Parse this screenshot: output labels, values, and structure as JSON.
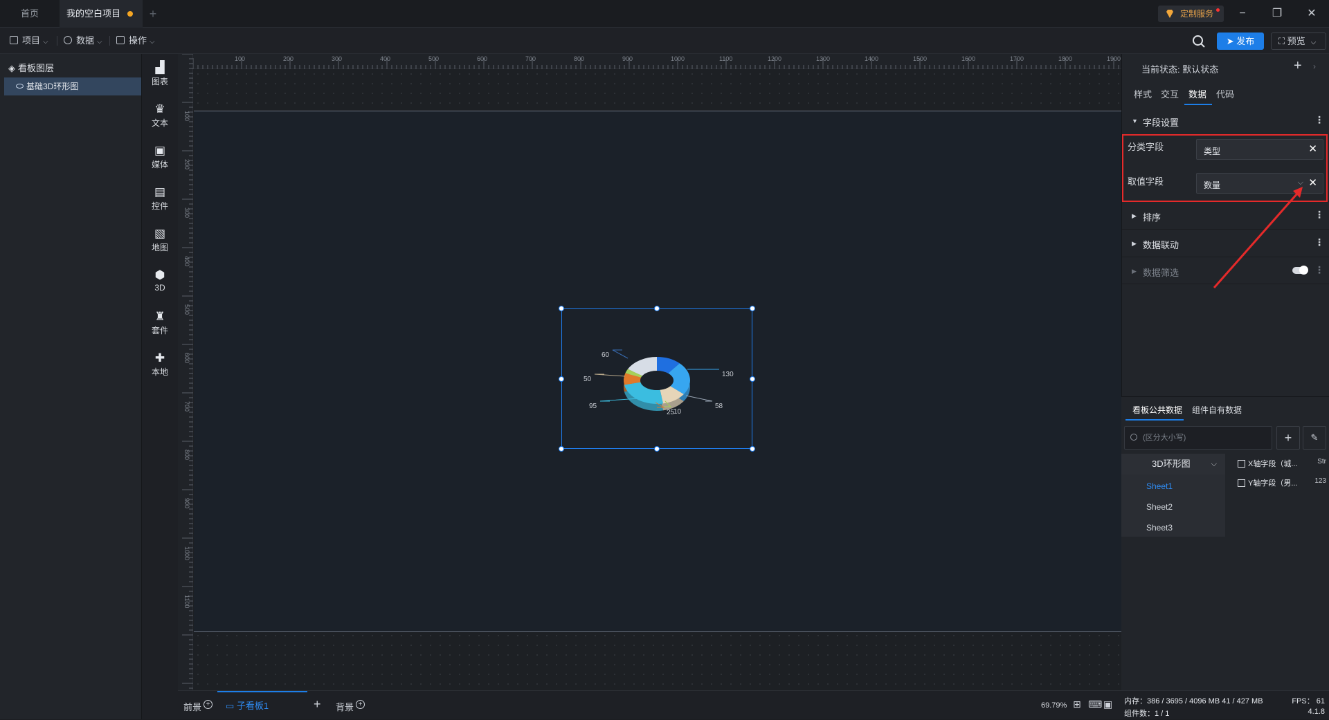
{
  "tabs": {
    "home": "首页",
    "project": "我的空白项目"
  },
  "header": {
    "custom_service": "定制服务"
  },
  "toolbar": {
    "project": "项目",
    "data": "数据",
    "operate": "操作",
    "publish": "发布",
    "preview": "预览"
  },
  "layers": {
    "title": "看板图层",
    "item": "基础3D环形图"
  },
  "components": [
    "图表",
    "文本",
    "媒体",
    "控件",
    "地图",
    "3D",
    "套件",
    "本地"
  ],
  "ruler": {
    "h_ticks": [
      "100",
      "200",
      "300",
      "400",
      "500",
      "600",
      "700",
      "800",
      "900",
      "1000",
      "1100",
      "1200",
      "1300",
      "1400",
      "1500",
      "1600",
      "1700",
      "1800",
      "1900"
    ],
    "v_ticks": [
      "100",
      "200",
      "300",
      "400",
      "500",
      "600",
      "700",
      "800",
      "900",
      "1000",
      "1100"
    ]
  },
  "chart": {
    "labels": [
      "60",
      "130",
      "50",
      "95",
      "58",
      "25",
      "10"
    ],
    "colors": [
      "#1f6fe0",
      "#37a6f0",
      "#e6d5b8",
      "#3bbde0",
      "#e07a2a",
      "#a6d05a",
      "#d7dde6"
    ]
  },
  "right_panel": {
    "state_label": "当前状态:",
    "state_value": "默认状态",
    "tabs": [
      "样式",
      "交互",
      "数据",
      "代码"
    ],
    "field_settings": "字段设置",
    "category_field_label": "分类字段",
    "category_field_value": "类型",
    "value_field_label": "取值字段",
    "value_field_value": "数量",
    "sort": "排序",
    "data_link": "数据联动",
    "data_filter": "数据筛选"
  },
  "data_source": {
    "tabs": [
      "看板公共数据",
      "组件自有数据"
    ],
    "search_placeholder": "(区分大小写)",
    "dataset": "3D环形图",
    "sheets": [
      "Sheet1",
      "Sheet2",
      "Sheet3"
    ],
    "columns": [
      {
        "name": "X轴字段（城...",
        "type": "Str"
      },
      {
        "name": "Y轴字段（男...",
        "type": "123"
      }
    ]
  },
  "bottom": {
    "front": "前景",
    "sub_board": "子看板1",
    "background": "背景",
    "zoom": "69.79%"
  },
  "status": {
    "memory": "内存：386 / 3695 / 4096 MB  41 / 427 MB",
    "fps": "FPS： 61",
    "components": "组件数：1 / 1",
    "version": "4.1.8"
  }
}
